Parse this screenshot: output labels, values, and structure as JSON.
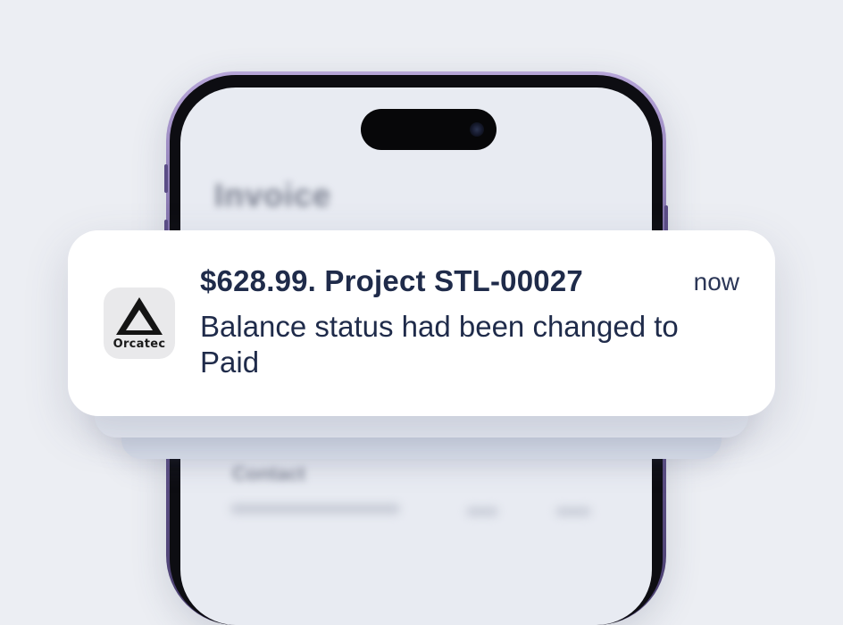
{
  "notification": {
    "app_name": "Orcatec",
    "app_icon": "orcatec-logo-icon",
    "title": "$628.99. Project STL-00027",
    "time": "now",
    "body": "Balance status had been changed to Paid"
  },
  "colors": {
    "background": "#eceef3",
    "phone_frame": "#6e5e99",
    "text": "#1f2b4a"
  }
}
